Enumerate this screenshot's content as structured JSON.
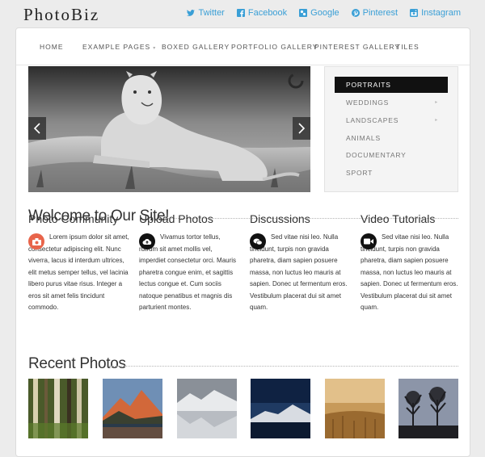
{
  "brand": {
    "logo": "PhotoBiz"
  },
  "social": [
    {
      "label": "Twitter",
      "icon": "twitter-icon"
    },
    {
      "label": "Facebook",
      "icon": "facebook-icon"
    },
    {
      "label": "Google",
      "icon": "google-icon"
    },
    {
      "label": "Pinterest",
      "icon": "pinterest-icon"
    },
    {
      "label": "Instagram",
      "icon": "instagram-icon"
    }
  ],
  "nav": [
    "HOME",
    "EXAMPLE PAGES",
    "BOXED GALLERY",
    "PORTFOLIO GALLERY",
    "PINTEREST GALLERY",
    "TILES"
  ],
  "categories": [
    "PORTRAITS",
    "WEDDINGS",
    "LANDSCAPES",
    "ANIMALS",
    "DOCUMENTARY",
    "SPORT"
  ],
  "welcome": {
    "title": "Welcome to Our Site!"
  },
  "features": [
    {
      "title": "Photo Community",
      "icon": "camera-icon",
      "color": "#e8644a",
      "text": "Lorem ipsum dolor sit amet, consectetur adipiscing elit. Nunc viverra, lacus id interdum ultrices, elit metus semper tellus, vel lacinia libero purus vitae risus. Integer a eros sit amet felis tincidunt commodo."
    },
    {
      "title": "Upload Photos",
      "icon": "cloud-upload-icon",
      "color": "#111111",
      "text": "Vivamus tortor tellus, rutrum sit amet mollis vel, imperdiet consectetur orci. Mauris pharetra congue enim, et sagittis lectus congue et. Cum sociis natoque penatibus et magnis dis parturient montes."
    },
    {
      "title": "Discussions",
      "icon": "chat-icon",
      "color": "#111111",
      "text": "Sed vitae nisi leo. Nulla tincidunt, turpis non gravida pharetra, diam sapien posuere massa, non luctus leo mauris at sapien. Donec ut fermentum eros. Vestibulum placerat dui sit amet quam."
    },
    {
      "title": "Video Tutorials",
      "icon": "video-camera-icon",
      "color": "#111111",
      "text": "Sed vitae nisi leo. Nulla tincidunt, turpis non gravida pharetra, diam sapien posuere massa, non luctus leo mauris at sapien. Donec ut fermentum eros. Vestibulum placerat dui sit amet quam."
    }
  ],
  "recent": {
    "title": "Recent Photos"
  },
  "colors": {
    "link": "#3a9fd6",
    "accent": "#e8644a",
    "panel": "#ffffff",
    "background": "#ececec"
  }
}
